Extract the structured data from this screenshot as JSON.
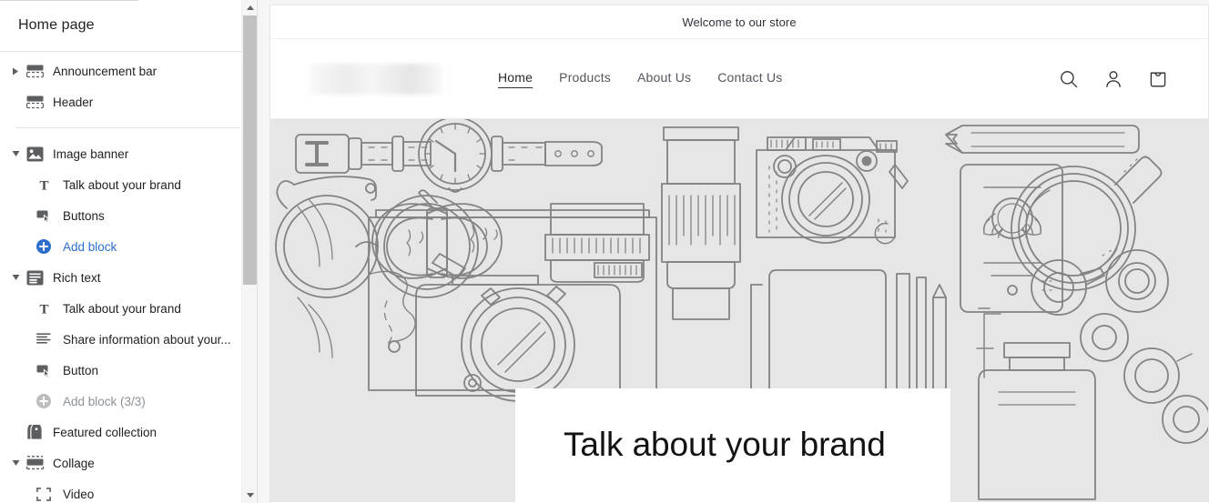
{
  "sidebar": {
    "title": "Home page",
    "scrollbar": {
      "name": "sidebar-scrollbar"
    },
    "sections": [
      {
        "id": "announcement-bar",
        "label": "Announcement bar",
        "icon": "announcement-bar-icon",
        "caret": "collapsed",
        "blocks": []
      },
      {
        "id": "header",
        "label": "Header",
        "icon": "header-icon",
        "caret": "none",
        "blocks": []
      },
      {
        "id": "image-banner",
        "label": "Image banner",
        "icon": "image-banner-icon",
        "caret": "expanded",
        "blocks": [
          {
            "id": "heading-block",
            "label": "Talk about your brand",
            "icon": "text-block-icon",
            "state": "normal"
          },
          {
            "id": "buttons-block",
            "label": "Buttons",
            "icon": "button-block-icon",
            "state": "normal"
          },
          {
            "id": "add-block",
            "label": "Add block",
            "icon": "plus-circle-icon",
            "state": "link"
          }
        ]
      },
      {
        "id": "rich-text",
        "label": "Rich text",
        "icon": "rich-text-icon",
        "caret": "expanded",
        "blocks": [
          {
            "id": "heading-block",
            "label": "Talk about your brand",
            "icon": "text-block-icon",
            "state": "normal"
          },
          {
            "id": "text-block",
            "label": "Share information about your...",
            "icon": "paragraph-block-icon",
            "state": "normal"
          },
          {
            "id": "button-block",
            "label": "Button",
            "icon": "button-block-icon",
            "state": "normal"
          },
          {
            "id": "add-block",
            "label": "Add block (3/3)",
            "icon": "plus-circle-icon",
            "state": "disabled"
          }
        ]
      },
      {
        "id": "featured-collection",
        "label": "Featured collection",
        "icon": "collection-tag-icon",
        "caret": "none",
        "blocks": []
      },
      {
        "id": "collage",
        "label": "Collage",
        "icon": "collage-icon",
        "caret": "expanded",
        "blocks": [
          {
            "id": "video-block",
            "label": "Video",
            "icon": "video-frame-icon",
            "state": "normal"
          }
        ]
      }
    ]
  },
  "preview": {
    "announcement_text": "Welcome to our store",
    "header": {
      "logo": "store-logo-placeholder",
      "nav": [
        {
          "label": "Home",
          "active": true
        },
        {
          "label": "Products",
          "active": false
        },
        {
          "label": "About Us",
          "active": false
        },
        {
          "label": "Contact Us",
          "active": false
        }
      ],
      "icons": [
        "search-icon",
        "account-icon",
        "cart-icon"
      ]
    },
    "banner": {
      "image": "line-art-accessories-placeholder",
      "background_color": "#e6e6e6",
      "card": {
        "heading": "Talk about your brand"
      }
    }
  },
  "colors": {
    "accent_link": "#2c6ecb",
    "text_primary": "#202223",
    "text_muted": "#8c9196",
    "sidebar_border": "#e3e3e3",
    "banner_bg": "#e6e6e6",
    "line_art": "#7c7c7c"
  }
}
